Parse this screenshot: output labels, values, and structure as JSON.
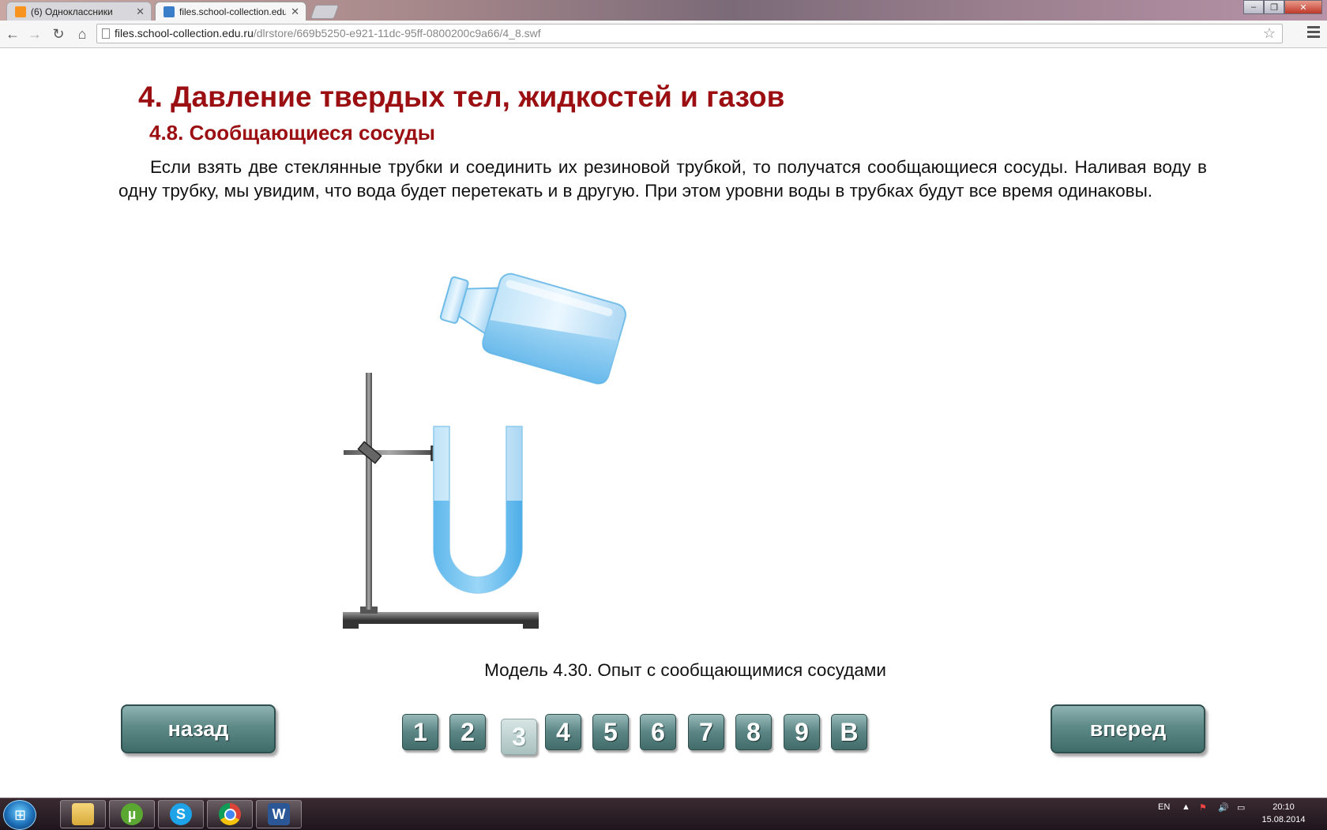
{
  "browser": {
    "tabs": [
      {
        "title": "(6) Одноклассники",
        "favicon_color": "#f7931e"
      },
      {
        "title": "files.school-collection.edu",
        "favicon_color": "#3a7dc9"
      }
    ],
    "url_host": "files.school-collection.edu.ru",
    "url_path": "/dlrstore/669b5250-e921-11dc-95ff-0800200c9a66/4_8.swf"
  },
  "content": {
    "chapter_title": "4. Давление твердых тел, жидкостей и газов",
    "section_title": "4.8. Сообщающиеся сосуды",
    "paragraph": "Если взять две стеклянные трубки и соединить их резиновой трубкой, то получатся сообщающиеся сосуды. Наливая воду в одну трубку, мы увидим, что вода будет перетекать и в другую. При этом уровни воды в трубках будут все время одинаковы.",
    "caption": "Модель 4.30. Опыт с сообщающимися сосудами",
    "back_label": "назад",
    "forward_label": "вперед",
    "pages": [
      "1",
      "2",
      "3",
      "4",
      "5",
      "6",
      "7",
      "8",
      "9",
      "В"
    ],
    "current_page": "3",
    "title_color": "#9b0f12",
    "button_color": "#5d8987"
  },
  "taskbar": {
    "apps": [
      "explorer-icon",
      "utorrent-icon",
      "skype-icon",
      "chrome-icon",
      "word-icon"
    ],
    "language": "EN",
    "time": "20:10",
    "date": "15.08.2014"
  }
}
